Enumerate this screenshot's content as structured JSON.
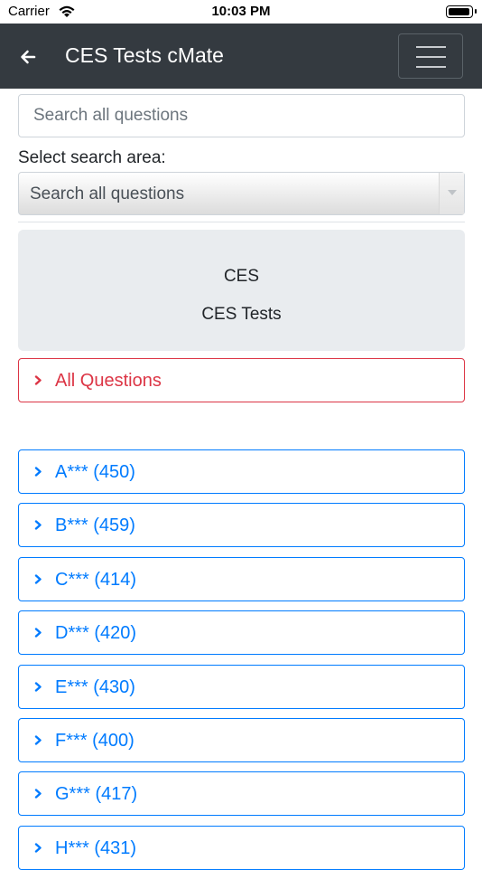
{
  "status": {
    "carrier": "Carrier",
    "time": "10:03 PM"
  },
  "header": {
    "title": "CES Tests cMate"
  },
  "search": {
    "placeholder": "Search all questions"
  },
  "area": {
    "label": "Select search area:",
    "selected": "Search all questions"
  },
  "card": {
    "line1": "CES",
    "line2": "CES Tests"
  },
  "all_questions": {
    "label": "All Questions"
  },
  "categories": [
    {
      "label": "A*** (450)"
    },
    {
      "label": "B*** (459)"
    },
    {
      "label": "C*** (414)"
    },
    {
      "label": "D*** (420)"
    },
    {
      "label": "E*** (430)"
    },
    {
      "label": "F*** (400)"
    },
    {
      "label": "G*** (417)"
    },
    {
      "label": "H*** (431)"
    }
  ],
  "colors": {
    "navbar": "#343a40",
    "primary": "#007bff",
    "danger": "#dc3545",
    "card": "#e9ecef"
  },
  "icons": {
    "back": "arrow-left-icon",
    "menu": "hamburger-icon",
    "item": "chevron-right-icon"
  }
}
